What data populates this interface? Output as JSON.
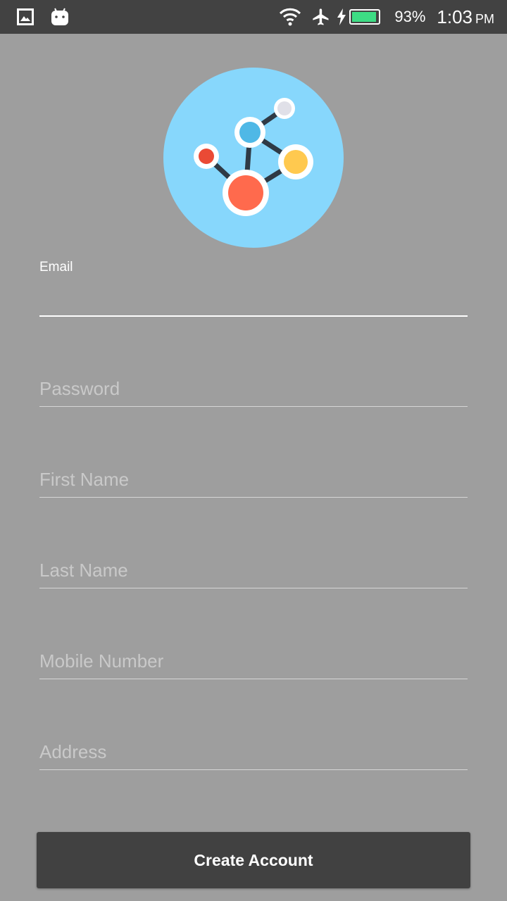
{
  "status_bar": {
    "battery_percent": "93%",
    "battery_level": 0.93,
    "time": "1:03",
    "ampm": "PM",
    "icons": [
      "image-icon",
      "android-icon",
      "wifi-icon",
      "airplane-icon",
      "charging-icon",
      "battery-icon"
    ]
  },
  "logo": {
    "icon": "molecule-network-icon",
    "colors": {
      "circle": "#87d7fc",
      "red": "#ff6a4d",
      "yellow": "#ffc94f",
      "blue": "#4fb8e6",
      "gray": "#e0e0e8"
    }
  },
  "form": {
    "email_label": "Email",
    "email_value": "",
    "password_placeholder": "Password",
    "first_name_placeholder": "First Name",
    "last_name_placeholder": "Last Name",
    "mobile_placeholder": "Mobile Number",
    "address_placeholder": "Address"
  },
  "submit_label": "Create Account",
  "colors": {
    "background": "#9e9e9e",
    "status_bar": "#424242",
    "button": "#414141"
  }
}
